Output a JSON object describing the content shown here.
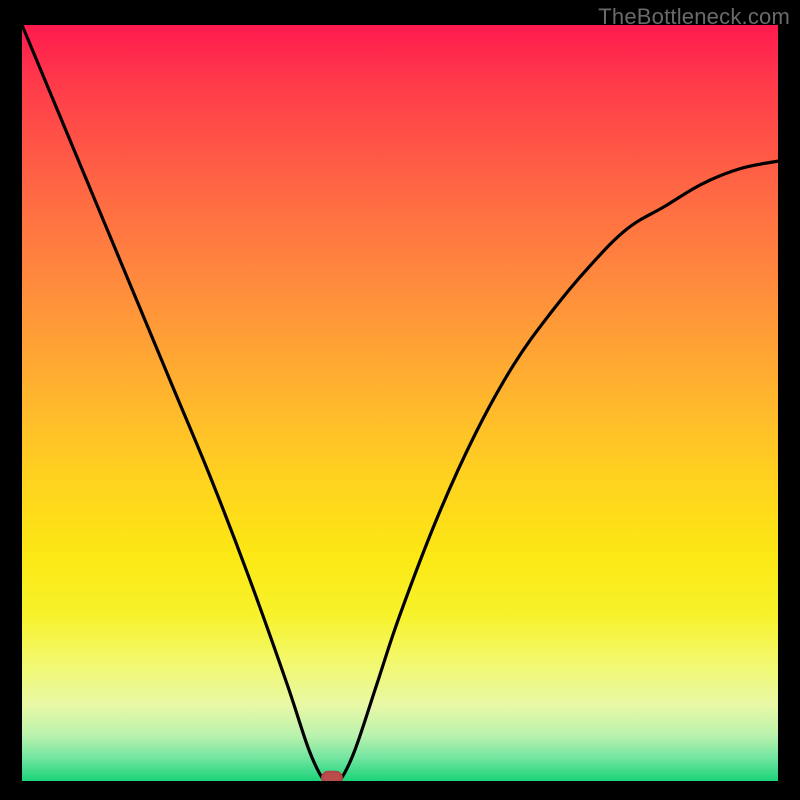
{
  "watermark": "TheBottleneck.com",
  "chart_data": {
    "type": "line",
    "title": "",
    "xlabel": "",
    "ylabel": "",
    "xlim": [
      0,
      100
    ],
    "ylim": [
      0,
      100
    ],
    "grid": false,
    "legend": false,
    "background_gradient": {
      "top": "#ff1a4e",
      "bottom": "#1bd37a",
      "stops": [
        "red",
        "orange",
        "yellow",
        "green"
      ]
    },
    "series": [
      {
        "name": "bottleneck-curve",
        "x": [
          0,
          5,
          10,
          15,
          20,
          25,
          30,
          35,
          38,
          40,
          41,
          42,
          44,
          47,
          50,
          55,
          60,
          65,
          70,
          75,
          80,
          85,
          90,
          95,
          100
        ],
        "y": [
          100,
          88,
          76,
          64,
          52,
          40,
          27,
          13,
          4,
          0,
          0,
          0,
          4,
          13,
          22,
          35,
          46,
          55,
          62,
          68,
          73,
          76,
          79,
          81,
          82
        ]
      }
    ],
    "marker": {
      "name": "optimal-point",
      "x": 41,
      "y": 0,
      "color": "#bb4c4c",
      "shape": "rounded-rect"
    }
  }
}
